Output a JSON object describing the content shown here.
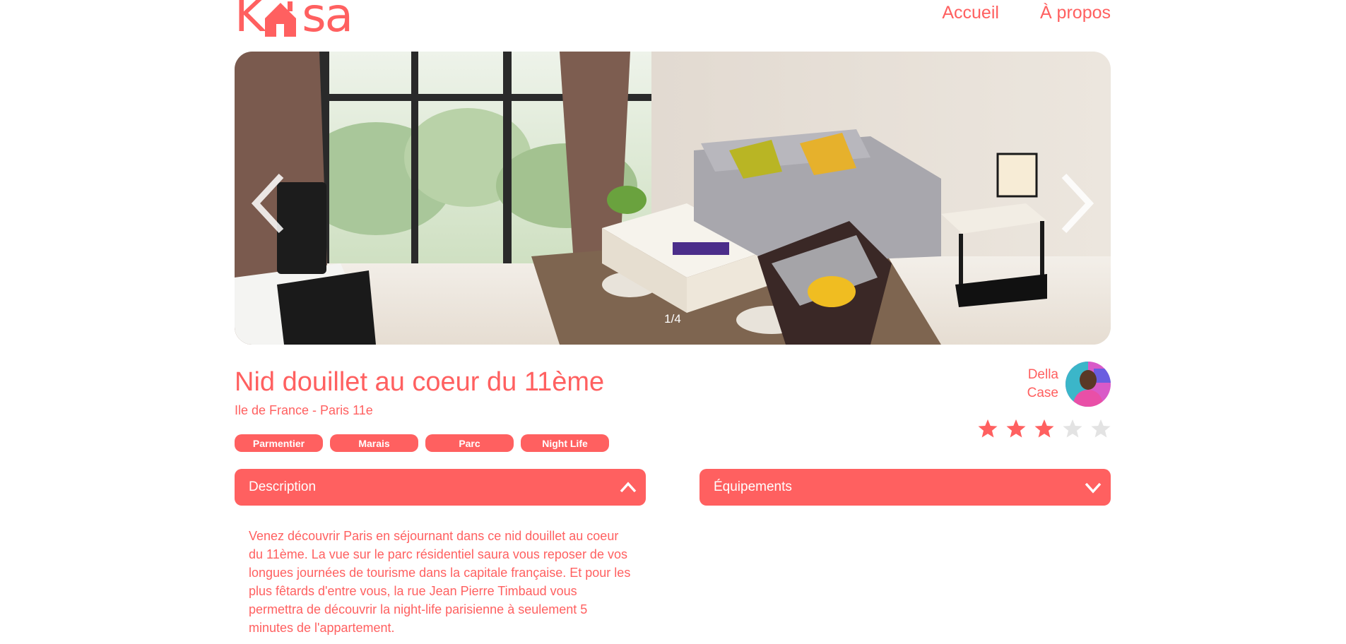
{
  "header": {
    "logo_letters": [
      "K",
      "sa"
    ],
    "logo_alt": "Kasa",
    "nav": [
      {
        "label": "Accueil"
      },
      {
        "label": "À propos"
      }
    ]
  },
  "carousel": {
    "counter": "1/4",
    "current": 1,
    "total": 4
  },
  "listing": {
    "title": "Nid douillet au coeur du 11ème",
    "location": "Ile de France - Paris 11e",
    "tags": [
      "Parmentier",
      "Marais",
      "Parc",
      "Night Life"
    ],
    "host": {
      "first_name": "Della",
      "last_name": "Case"
    },
    "rating": 3,
    "rating_max": 5
  },
  "collapses": {
    "description": {
      "label": "Description",
      "text": "Venez découvrir Paris en séjournant dans ce nid douillet au coeur du 11ème. La vue sur le parc résidentiel saura vous reposer de vos longues journées de tourisme dans la capitale française. Et pour les plus fêtards d'entre vous, la rue Jean Pierre Timbaud vous permettra de découvrir la night-life parisienne à seulement 5 minutes de l'appartement."
    },
    "equipements": {
      "label": "Équipements"
    }
  },
  "colors": {
    "accent": "#FF6060",
    "star_off": "#E3E3E3"
  }
}
